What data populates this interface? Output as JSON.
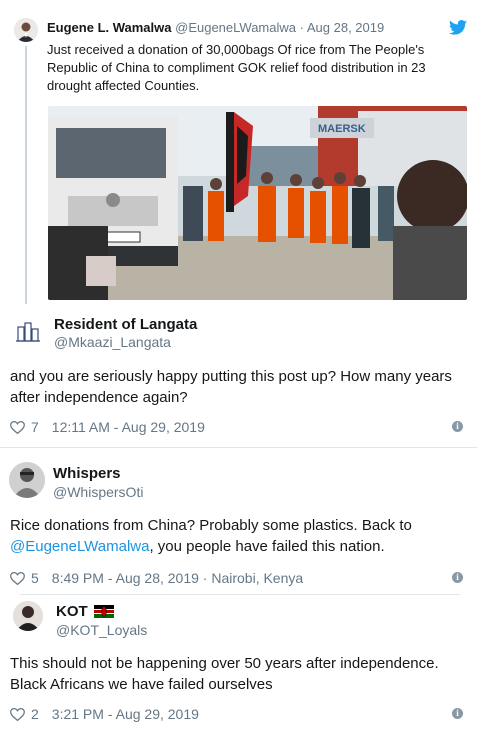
{
  "tweet1": {
    "name": "Eugene L. Wamalwa",
    "handle": "@EugeneLWamalwa",
    "sep": "·",
    "date": "Aug 28, 2019",
    "text": "Just received a donation of 30,000bags Of rice from The People's Republic of China to compliment GOK relief food distribution in 23 drought affected Counties.",
    "image_alt": "MAERSK"
  },
  "reply1": {
    "name": "Resident of Langata",
    "handle": "@Mkaazi_Langata",
    "text": "and you are seriously happy putting this post up? How many years after independence again?",
    "likes": "7",
    "time": "12:11 AM - Aug 29, 2019"
  },
  "reply2": {
    "name": "Whispers",
    "handle": "@WhispersOti",
    "text_before": "Rice donations from China? Probably some plastics. Back to",
    "mention": "@EugeneLWamalwa",
    "text_after": ", you people have failed this nation.",
    "likes": "5",
    "time": "8:49 PM - Aug 28, 2019 · Nairobi, Kenya"
  },
  "reply3": {
    "name": "KOT",
    "handle": "@KOT_Loyals",
    "text": "This should not be happening over 50 years after independence. Black Africans we have failed ourselves",
    "likes": "2",
    "time": "3:21 PM - Aug 29, 2019"
  },
  "colors": {
    "twitter_blue": "#1da1f2",
    "link": "#1b95e0",
    "muted": "#657786"
  },
  "icons": {
    "info": "i"
  }
}
